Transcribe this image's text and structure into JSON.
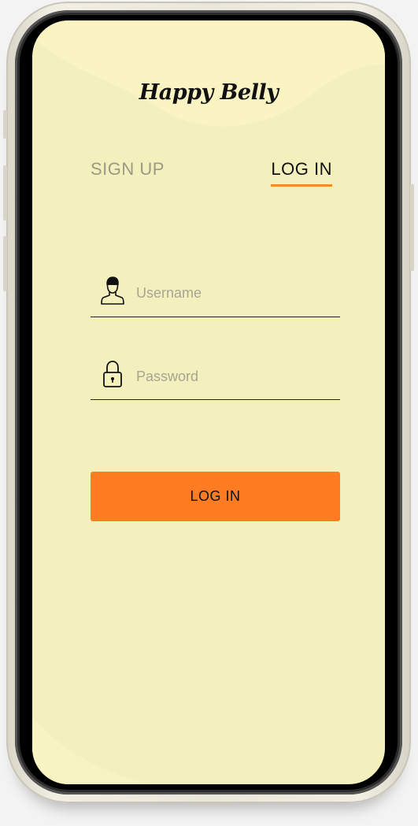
{
  "app": {
    "logo_text": "Happy Belly"
  },
  "tabs": [
    {
      "label": "SIGN UP",
      "active": false
    },
    {
      "label": "LOG IN",
      "active": true
    }
  ],
  "form": {
    "username": {
      "placeholder": "Username",
      "value": "",
      "icon": "user-icon"
    },
    "password": {
      "placeholder": "Password",
      "value": "",
      "icon": "lock-icon"
    },
    "submit_label": "LOG IN"
  },
  "colors": {
    "screen_background": "#f4f0bd",
    "accent": "#ff7c23",
    "tab_underline": "#f48a2a",
    "inactive_text": "#9a9a86"
  }
}
